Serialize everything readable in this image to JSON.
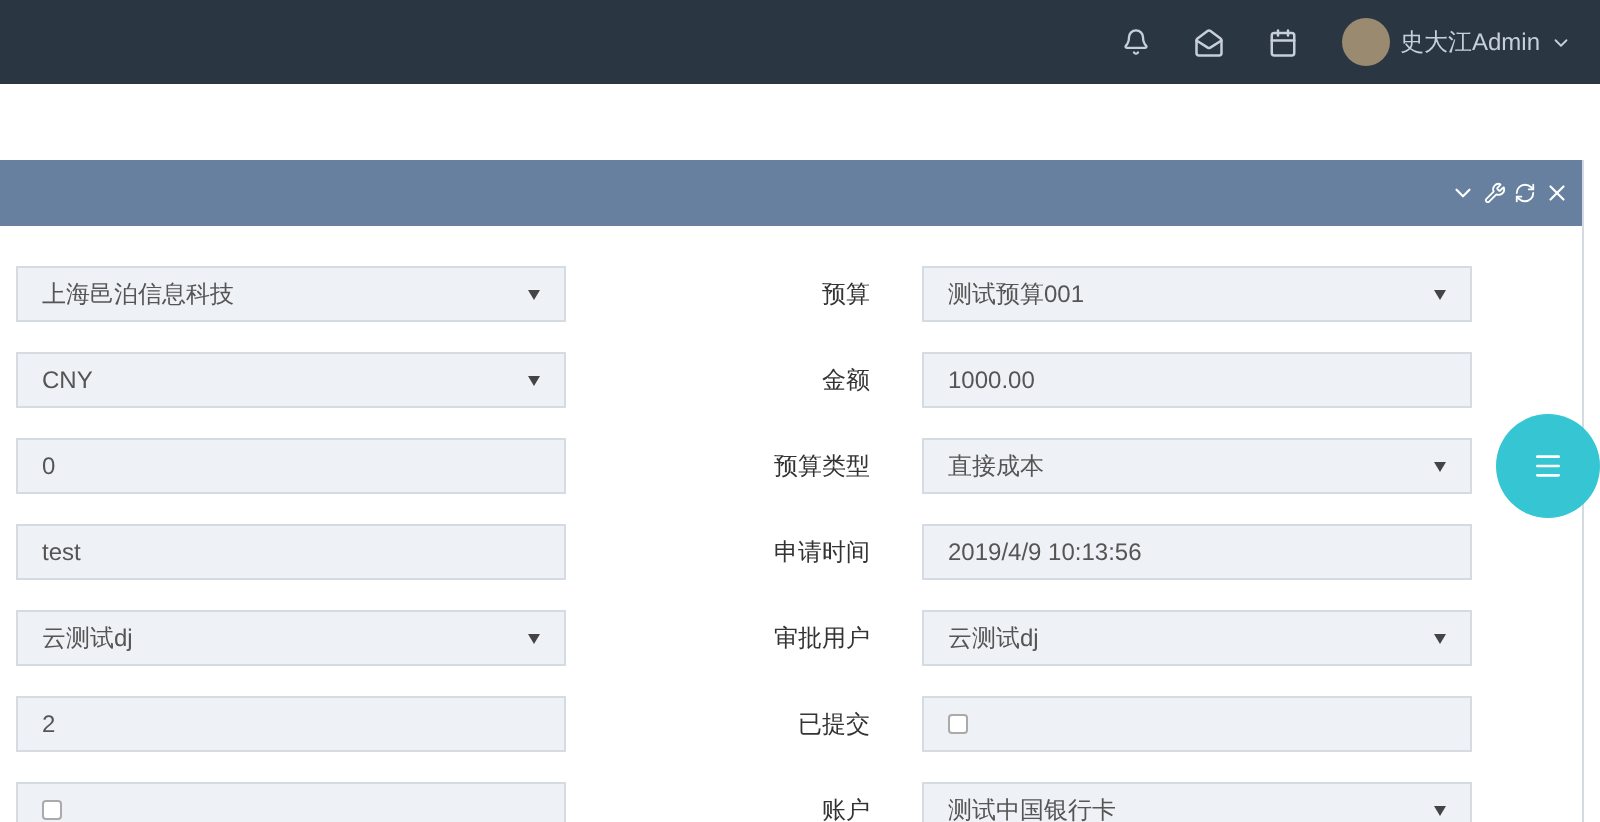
{
  "top_bar": {
    "user_name": "史大江Admin"
  },
  "form_rows": [
    {
      "left": {
        "kind": "select",
        "value": "上海邑泊信息科技"
      },
      "right": {
        "label": "预算",
        "kind": "select",
        "value": "测试预算001"
      }
    },
    {
      "left": {
        "kind": "select",
        "value": "CNY"
      },
      "right": {
        "label": "金额",
        "kind": "input",
        "value": "1000.00"
      }
    },
    {
      "left": {
        "kind": "input",
        "value": "0"
      },
      "right": {
        "label": "预算类型",
        "kind": "select",
        "value": "直接成本"
      }
    },
    {
      "left": {
        "kind": "input",
        "value": "test"
      },
      "right": {
        "label": "申请时间",
        "kind": "input",
        "value": "2019/4/9 10:13:56"
      }
    },
    {
      "left": {
        "kind": "select",
        "value": "云测试dj"
      },
      "right": {
        "label": "审批用户",
        "kind": "select",
        "value": "云测试dj"
      }
    },
    {
      "left": {
        "kind": "input",
        "value": "2"
      },
      "right": {
        "label": "已提交",
        "kind": "checkbox",
        "checked": false
      }
    },
    {
      "left": {
        "kind": "checkbox",
        "checked": false
      },
      "right": {
        "label": "账户",
        "kind": "select",
        "value": "测试中国银行卡"
      }
    }
  ]
}
